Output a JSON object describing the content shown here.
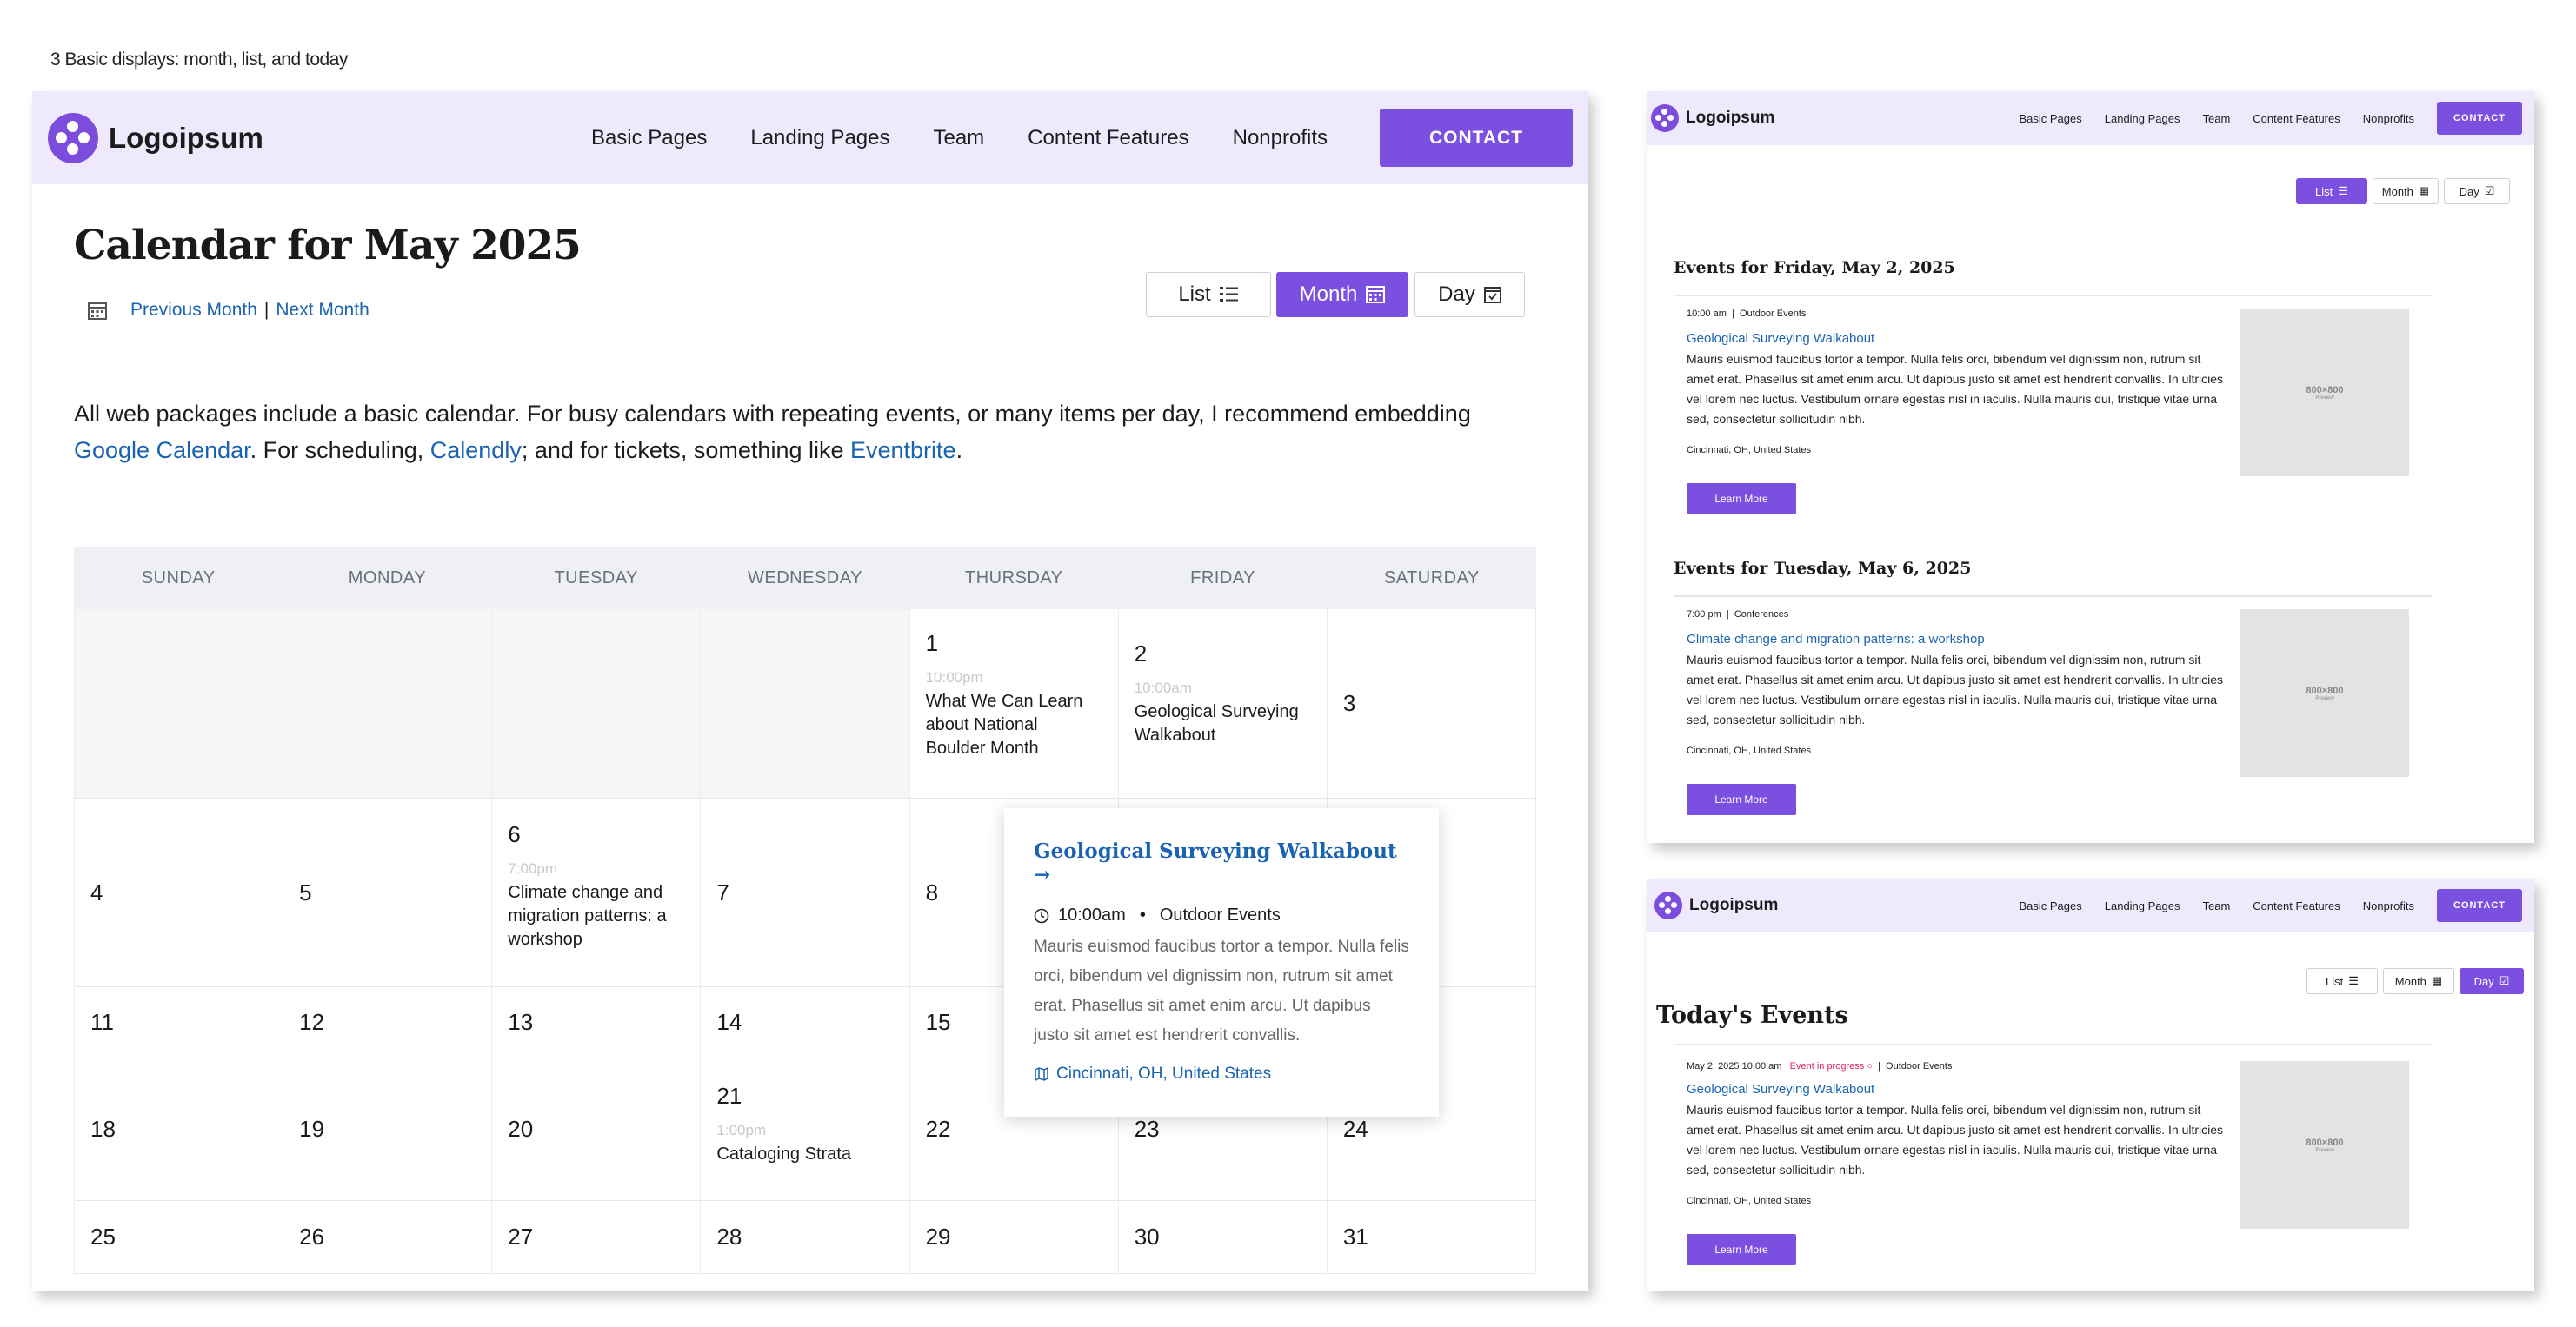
{
  "caption": "3 Basic displays: month, list, and today",
  "brand": {
    "name": "Logoipsum",
    "accent": "#7b4fe0",
    "header_bg": "#efe9fe",
    "link": "#1a63b0"
  },
  "nav": {
    "items": [
      "Basic Pages",
      "Landing Pages",
      "Team",
      "Content Features",
      "Nonprofits"
    ],
    "cta": "CONTACT"
  },
  "month_view": {
    "title": "Calendar for May 2025",
    "prev": "Previous Month",
    "sep": "|",
    "next": "Next Month",
    "views": {
      "list": "List",
      "month": "Month",
      "day": "Day"
    },
    "intro": {
      "t1": "All web packages include a basic calendar. For busy calendars with repeating events, or many items per day, I recommend embedding ",
      "l1": "Google Calendar",
      "t2": ". For scheduling, ",
      "l2": "Calendly",
      "t3": "; and for tickets, something like ",
      "l3": "Eventbrite",
      "t4": "."
    },
    "weekdays": [
      "SUNDAY",
      "MONDAY",
      "TUESDAY",
      "WEDNESDAY",
      "THURSDAY",
      "FRIDAY",
      "SATURDAY"
    ],
    "days": {
      "d1": "1",
      "d2": "2",
      "d3": "3",
      "d4": "4",
      "d5": "5",
      "d6": "6",
      "d7": "7",
      "d8": "8",
      "d11": "11",
      "d12": "12",
      "d13": "13",
      "d14": "14",
      "d15": "15",
      "d18": "18",
      "d19": "19",
      "d20": "20",
      "d21": "21",
      "d22": "22",
      "d23": "23",
      "d24": "24",
      "d25": "25",
      "d26": "26",
      "d27": "27",
      "d28": "28",
      "d29": "29",
      "d30": "30",
      "d31": "31"
    },
    "events": {
      "e1": {
        "time": "10:00pm",
        "name": "What We Can Learn about National Boulder Month"
      },
      "e2": {
        "time": "10:00am",
        "name": "Geological Surveying Walkabout"
      },
      "e6": {
        "time": "7:00pm",
        "name": "Climate change and migration patterns: a workshop"
      },
      "e21": {
        "time": "1:00pm",
        "name": "Cataloging Strata"
      }
    },
    "popup": {
      "title": "Geological Surveying Walkabout →",
      "time": "10:00am",
      "dot": "•",
      "category": "Outdoor Events",
      "body": "Mauris euismod faucibus tortor a tempor. Nulla felis orci, bibendum vel dignissim non, rutrum sit amet erat. Phasellus sit amet enim arcu. Ut dapibus justo sit amet est hendrerit convallis.",
      "location": "Cincinnati, OH, United States"
    }
  },
  "list_view": {
    "views": {
      "list": "List",
      "month": "Month",
      "day": "Day"
    },
    "sections": [
      {
        "heading": "Events for Friday, May 2, 2025",
        "meta_time": "10:00 am",
        "meta_cat": "Outdoor Events",
        "title": "Geological Surveying Walkabout",
        "body": "Mauris euismod faucibus tortor a tempor. Nulla felis orci, bibendum vel dignissim non, rutrum sit amet erat. Phasellus sit amet enim arcu. Ut dapibus justo sit amet est hendrerit convallis. In ultricies vel lorem nec luctus. Vestibulum ornare egestas nisl in iaculis. Nulla mauris dui, tristique vitae urna sed, consectetur sollicitudin nibh.",
        "location": "Cincinnati, OH, United States",
        "button": "Learn More",
        "image": "800×800",
        "image_sub": "Preview"
      },
      {
        "heading": "Events for Tuesday, May 6, 2025",
        "meta_time": "7:00 pm",
        "meta_cat": "Conferences",
        "title": "Climate change and migration patterns: a workshop",
        "body": "Mauris euismod faucibus tortor a tempor. Nulla felis orci, bibendum vel dignissim non, rutrum sit amet erat. Phasellus sit amet enim arcu. Ut dapibus justo sit amet est hendrerit convallis. In ultricies vel lorem nec luctus. Vestibulum ornare egestas nisl in iaculis. Nulla mauris dui, tristique vitae urna sed, consectetur sollicitudin nibh.",
        "location": "Cincinnati, OH, United States",
        "button": "Learn More",
        "image": "800×800",
        "image_sub": "Preview"
      }
    ]
  },
  "day_view": {
    "views": {
      "list": "List",
      "month": "Month",
      "day": "Day"
    },
    "heading": "Today's Events",
    "meta_time": "May 2, 2025 10:00 am",
    "meta_status": "Event in progress ○",
    "meta_cat": "Outdoor Events",
    "title": "Geological Surveying Walkabout",
    "body": "Mauris euismod faucibus tortor a tempor. Nulla felis orci, bibendum vel dignissim non, rutrum sit amet erat. Phasellus sit amet enim arcu. Ut dapibus justo sit amet est hendrerit convallis. In ultricies vel lorem nec luctus. Vestibulum ornare egestas nisl in iaculis. Nulla mauris dui, tristique vitae urna sed, consectetur sollicitudin nibh.",
    "location": "Cincinnati, OH, United States",
    "button": "Learn More",
    "image": "800×800",
    "image_sub": "Preview"
  }
}
